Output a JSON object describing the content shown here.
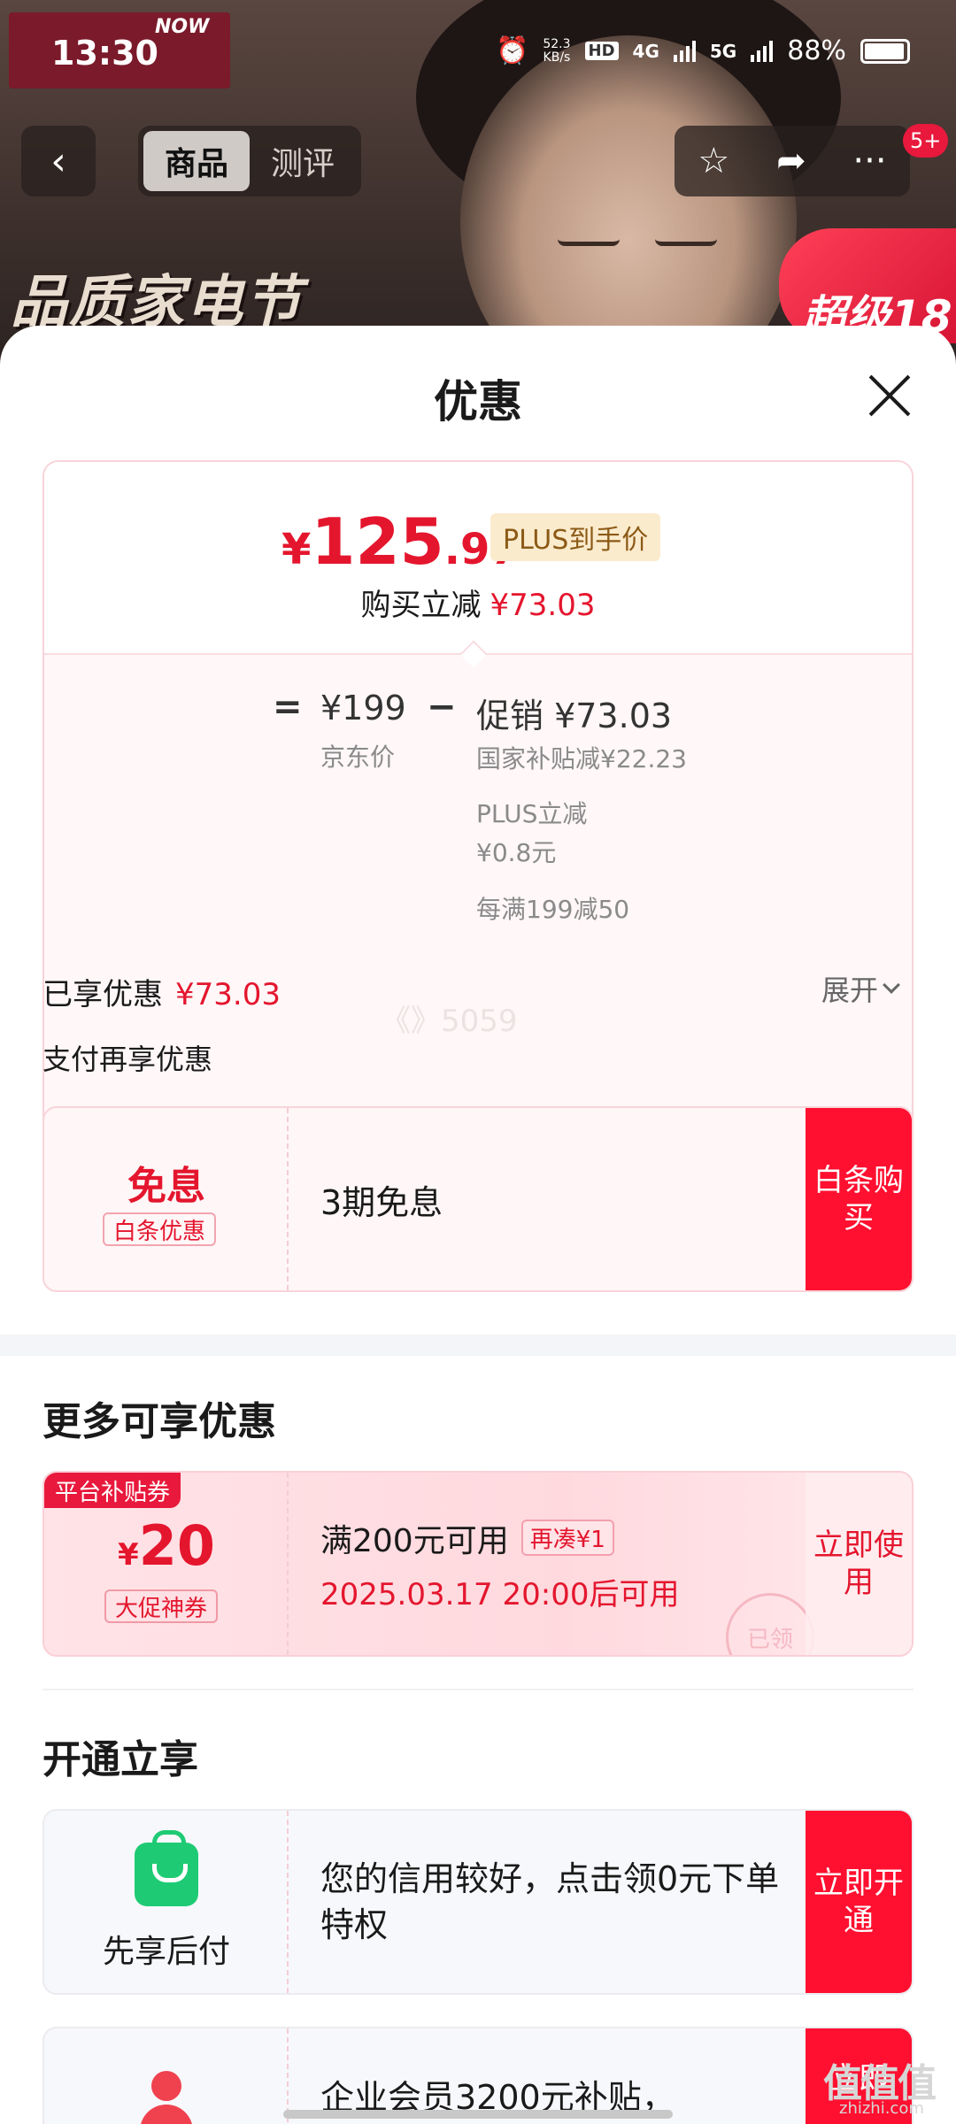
{
  "status_bar": {
    "time": "13:30",
    "speed": "52.3",
    "speed_unit": "KB/s",
    "hd": "HD",
    "net1": "4G",
    "net2": "5G",
    "battery": "88%"
  },
  "background": {
    "logo_text": "NOW",
    "promo_title": "品质家电节",
    "promo_right": "超级18"
  },
  "nav": {
    "tabs": [
      {
        "label": "商品",
        "active": true
      },
      {
        "label": "测评",
        "active": false
      }
    ],
    "badge": "5+"
  },
  "sheet": {
    "title": "优惠"
  },
  "price_card": {
    "currency": "¥",
    "price_int": "125",
    "price_dec": ".97",
    "plus_tag": "PLUS到手价",
    "reduce_label": "购买立减",
    "reduce_value": "¥73.03",
    "eq": "=",
    "jd_price": "¥199",
    "jd_label": "京东价",
    "minus": "−",
    "promo_head": "促销 ¥73.03",
    "promo_details": [
      "国家补贴减¥22.23",
      "PLUS立减",
      "¥0.8元",
      "每满199减50"
    ]
  },
  "enjoyed": {
    "label": "已享优惠",
    "value": "¥73.03",
    "expand": "展开",
    "watermark": "《》5059",
    "pay_more": "支付再享优惠"
  },
  "baitiao_card": {
    "big": "免息",
    "tag": "白条优惠",
    "text": "3期免息",
    "cta": "白条购买"
  },
  "more": {
    "title": "更多可享优惠"
  },
  "coupon": {
    "corner": "平台补贴券",
    "currency": "¥",
    "amount": "20",
    "tag": "大促神券",
    "line1": "满200元可用",
    "line1_tag": "再凑¥1",
    "line2": "2025.03.17 20:00后可用",
    "stamp": "已领",
    "cta": "立即使用"
  },
  "open": {
    "title": "开通立享"
  },
  "paylater_card": {
    "label": "先享后付",
    "text": "您的信用较好，点击领0元下单特权",
    "cta": "立即开通"
  },
  "enterprise_card": {
    "text": "企业会员3200元补贴，",
    "cta": "立即"
  },
  "corner_mark": {
    "logo": "值值值",
    "url": "zhizhi.com"
  }
}
